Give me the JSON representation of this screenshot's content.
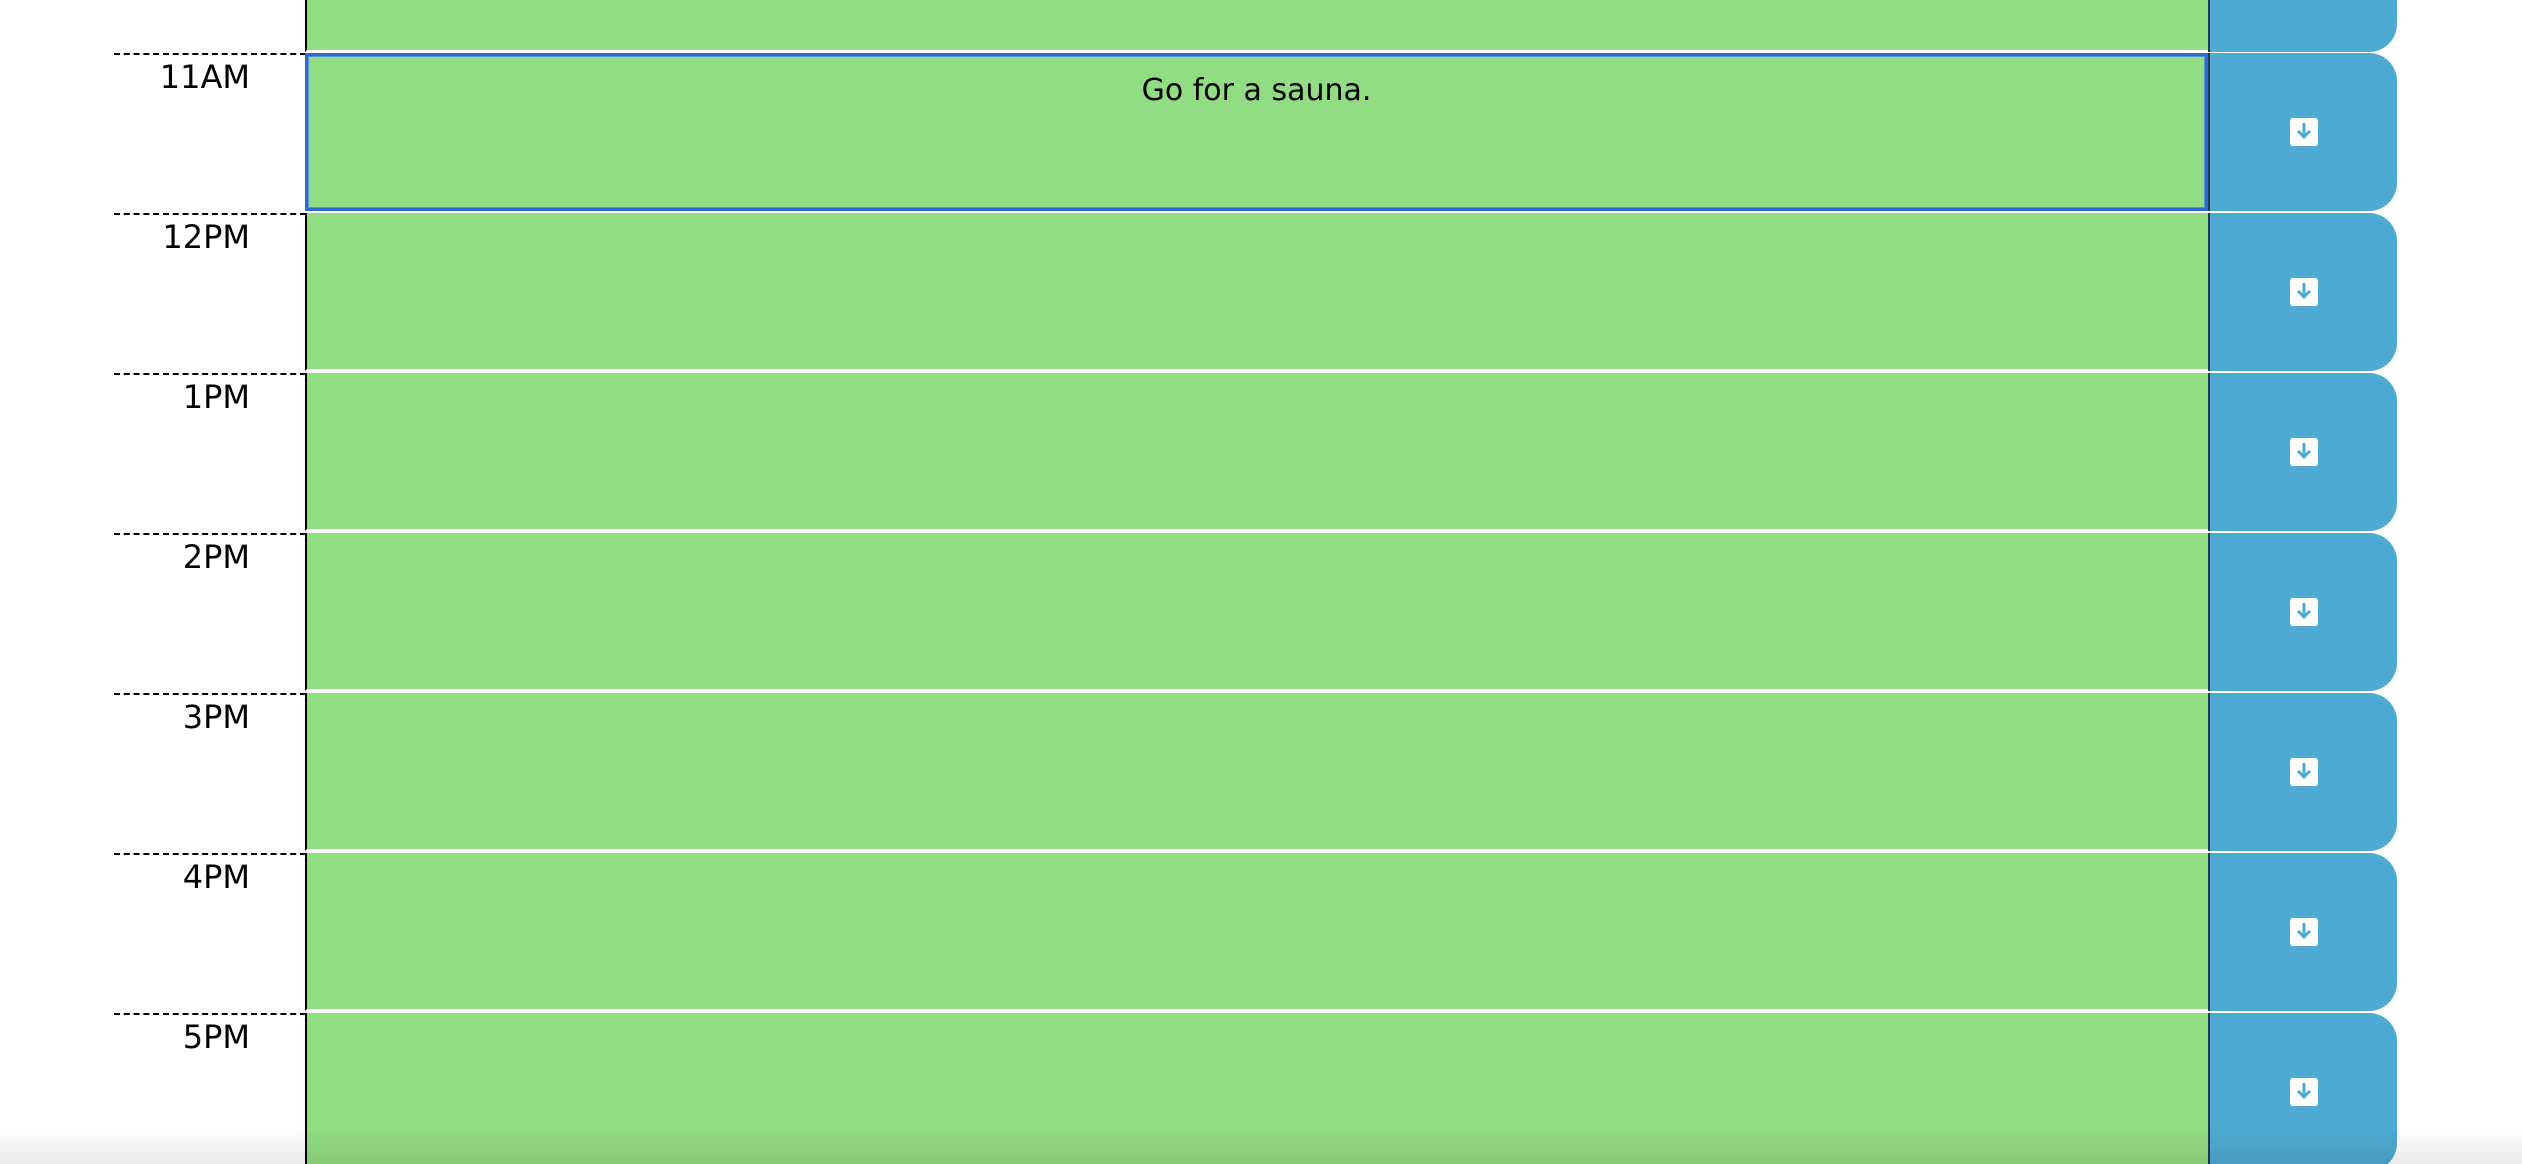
{
  "planner": {
    "blocks": [
      {
        "hour": "",
        "text": "",
        "state": "future"
      },
      {
        "hour": "11AM",
        "text": "Go for a sauna.",
        "state": "future",
        "focused": true
      },
      {
        "hour": "12PM",
        "text": "",
        "state": "future"
      },
      {
        "hour": "1PM",
        "text": "",
        "state": "future"
      },
      {
        "hour": "2PM",
        "text": "",
        "state": "future"
      },
      {
        "hour": "3PM",
        "text": "",
        "state": "future"
      },
      {
        "hour": "4PM",
        "text": "",
        "state": "future"
      },
      {
        "hour": "5PM",
        "text": "",
        "state": "future"
      }
    ],
    "save_icon": "save-download-icon"
  },
  "colors": {
    "future": "#92dc84",
    "save_button": "#4eaad2",
    "focus_border": "#2a6ec6",
    "text": "#000000"
  }
}
